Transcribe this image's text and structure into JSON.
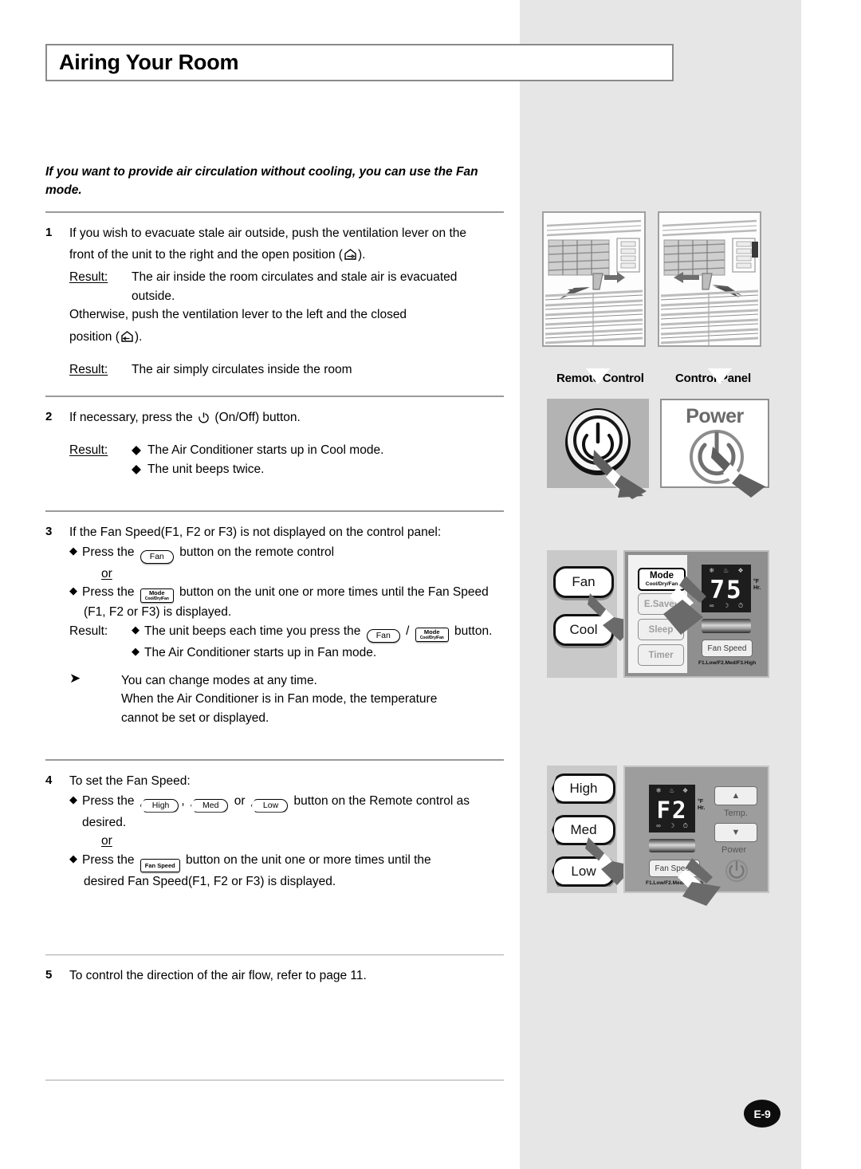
{
  "page": {
    "title": "Airing Your Room",
    "page_number": "E-9"
  },
  "intro": "If you want to provide air circulation without cooling, you can use the Fan mode.",
  "steps": [
    {
      "num": "1",
      "lines": [
        "If you wish to evacuate stale air outside, push the ventilation lever on the",
        "front of the unit to the right and the open position (",
        ").",
        "Otherwise, push the ventilation lever to the left and the closed",
        "position (",
        ")."
      ],
      "result_label": "Result:",
      "result_lines": [
        "The air inside the room circulates and stale air is evacuated",
        "outside."
      ],
      "result_label_2": "Result:",
      "result_2": "The air simply circulates inside the room"
    },
    {
      "num": "2",
      "text_before": "If necessary, press the",
      "text_after": "(On/Off) button.",
      "result_label": "Result:",
      "bullets": [
        "The Air Conditioner starts up in Cool mode.",
        "The unit beeps twice."
      ]
    },
    {
      "num": "3",
      "heading": "If the Fan Speed(F1, F2 or F3) is not displayed on the control panel:",
      "b1_pre": "Press the",
      "b1_btn": "Fan",
      "b1_post": "button on the remote control",
      "or": "or",
      "b2_pre": "Press the",
      "b2_btn_l1": "Mode",
      "b2_btn_l2": "Cool/Dry/Fan",
      "b2_post": "button on the unit one or more times until the Fan Speed",
      "b2_post2": "(F1, F2 or F3) is displayed.",
      "result_label": "Result:",
      "r1_pre": "The unit beeps each time you press the",
      "r1_btn_a": "Fan",
      "r1_sep": "/",
      "r1_btn_b_l1": "Mode",
      "r1_btn_b_l2": "Cool/Dry/Fan",
      "r1_post": "button.",
      "r2": "The Air Conditioner starts up in Fan mode.",
      "note_lines": [
        "You can change modes at any time.",
        "When the Air Conditioner is in Fan mode, the temperature",
        "cannot be set or displayed."
      ]
    },
    {
      "num": "4",
      "heading": "To set the Fan Speed:",
      "b1_pre": "Press the",
      "b1_btn_high": "High",
      "b1_comma": ",",
      "b1_btn_med": "Med",
      "b1_or": "or",
      "b1_btn_low": "Low",
      "b1_post": "button on the Remote control as desired.",
      "or": "or",
      "b2_pre": "Press the",
      "b2_btn": "Fan Speed",
      "b2_post": "button on the unit one or more times until the",
      "b2_post2": "desired Fan Speed(F1, F2 or F3) is displayed."
    },
    {
      "num": "5",
      "text": "To control the direction of the air flow, refer to page 11."
    }
  ],
  "figures": {
    "vent_open_caption": "ventilation-lever-open",
    "vent_closed_caption": "ventilation-lever-closed",
    "label_remote": "Remote Control",
    "label_panel": "Control Panel",
    "power_word": "Power",
    "remote_mode_buttons": [
      "Fan",
      "Cool"
    ],
    "remote_speed_buttons": [
      "High",
      "Med",
      "Low"
    ],
    "panel_buttons": [
      {
        "label": "Mode",
        "sub": "Cool/Dry/Fan",
        "active": true
      },
      {
        "label": "E.Saver",
        "sub": "",
        "active": false
      },
      {
        "label": "Sleep",
        "sub": "",
        "active": false
      },
      {
        "label": "Timer",
        "sub": "",
        "active": false
      }
    ],
    "lcd_mode": {
      "value": "75",
      "unit_top": "°F",
      "unit_bottom": "Hr.",
      "top_icons": [
        "snowflake",
        "drop",
        "fan"
      ],
      "bottom_icons": [
        "esaver",
        "sleep",
        "timer"
      ]
    },
    "lcd_speed": {
      "value": "F2",
      "unit_top": "°F",
      "unit_bottom": "Hr.",
      "top_icons": [
        "snowflake",
        "drop",
        "fan"
      ],
      "bottom_icons": [
        "esaver",
        "sleep",
        "timer"
      ]
    },
    "fan_speed_button": "Fan Speed",
    "fan_speed_legend": "F1.Low/F2.Med/F3.High",
    "temp_label": "Temp.",
    "power_label": "Power",
    "temp_up": "▲",
    "temp_down": "▼"
  },
  "colors": {
    "band": "#e6e6e6",
    "rule": "#9a9a9a",
    "panel_gray": "#8f8f8f",
    "lcd": "#1d1d1d",
    "page_badge": "#0d0d0d"
  }
}
